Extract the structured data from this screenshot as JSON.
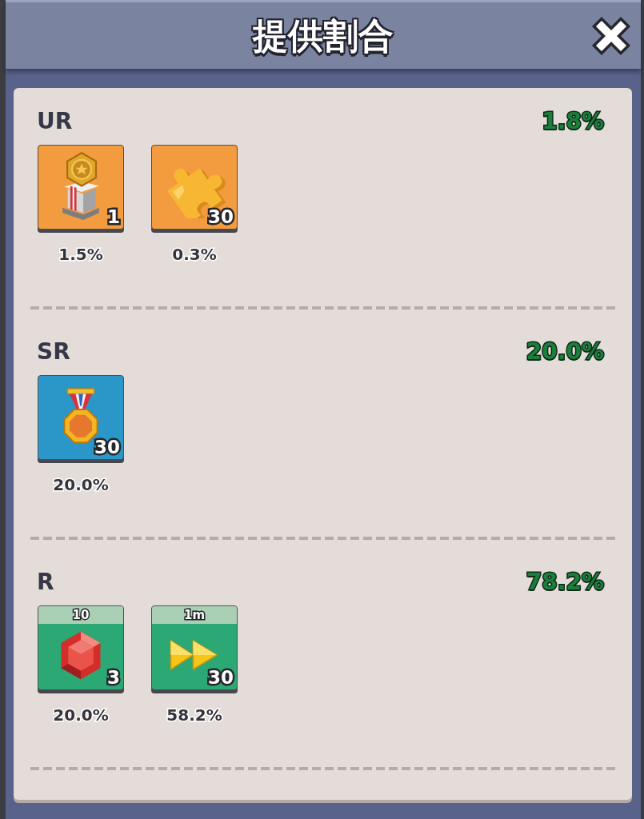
{
  "window": {
    "title": "提供割合"
  },
  "tiers": [
    {
      "label": "UR",
      "total": "1.8%",
      "color": "#f29c3f",
      "items": [
        {
          "kind": "medal-stand",
          "count": "1",
          "chance": "1.5%"
        },
        {
          "kind": "puzzle-piece",
          "count": "30",
          "chance": "0.3%"
        }
      ]
    },
    {
      "label": "SR",
      "total": "20.0%",
      "color": "#2b97c9",
      "items": [
        {
          "kind": "medal",
          "count": "30",
          "chance": "20.0%"
        }
      ]
    },
    {
      "label": "R",
      "total": "78.2%",
      "color": "#2ba874",
      "items": [
        {
          "kind": "gem",
          "tag": "10",
          "count": "3",
          "chance": "20.0%"
        },
        {
          "kind": "fast-forward",
          "tag": "1m",
          "count": "30",
          "chance": "58.2%"
        }
      ]
    }
  ]
}
